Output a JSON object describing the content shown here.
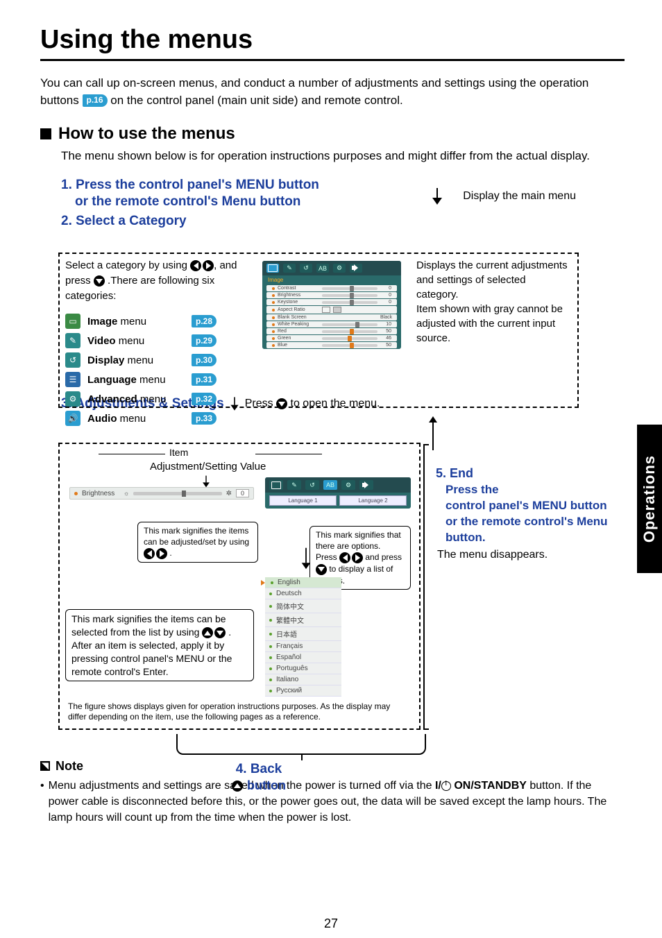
{
  "page_number": "27",
  "sidetab": "Operations",
  "title": "Using the menus",
  "intro_a": "You can call up on-screen menus, and conduct a number of adjustments and settings using the operation buttons ",
  "intro_pref": "p.16",
  "intro_b": " on the control panel (main unit side) and remote control.",
  "howto_heading": "How to use the menus",
  "howto_sub": "The menu shown below is for operation instructions purposes and might differ from the actual display.",
  "step1_a": "1. Press the control panel's MENU button",
  "step1_b": "or the remote control's Menu button",
  "display_main": "Display the main menu",
  "step2": "2. Select a Category",
  "select_cat_a": "Select a category by using ",
  "select_cat_b": ", and press ",
  "select_cat_c": " .There are following six categories:",
  "menus": [
    {
      "name": "Image",
      "suffix": " menu",
      "page": "p.28"
    },
    {
      "name": "Video",
      "suffix": " menu",
      "page": "p.29"
    },
    {
      "name": "Display",
      "suffix": " menu",
      "page": "p.30"
    },
    {
      "name": "Language",
      "suffix": " menu",
      "page": "p.31"
    },
    {
      "name": "Advanced",
      "suffix": " menu",
      "page": "p.32"
    },
    {
      "name": "Audio",
      "suffix": " menu",
      "page": "p.33"
    }
  ],
  "osd": {
    "title": "Image",
    "rows": [
      {
        "label": "Contrast",
        "val": "0",
        "thumb": 50
      },
      {
        "label": "Brightness",
        "val": "0",
        "thumb": 50
      },
      {
        "label": "Keystone",
        "val": "0",
        "thumb": 50
      },
      {
        "label": "Aspect Ratio",
        "val": "",
        "thumb": null,
        "icon": true
      },
      {
        "label": "Blank Screen",
        "val": "Black",
        "thumb": null
      },
      {
        "label": "White Peaking",
        "val": "10",
        "thumb": 60
      },
      {
        "label": "Red",
        "val": "50",
        "thumb": 50,
        "color": true
      },
      {
        "label": "Green",
        "val": "46",
        "thumb": 46,
        "color": true
      },
      {
        "label": "Blue",
        "val": "50",
        "thumb": 50,
        "color": true
      }
    ]
  },
  "cat_right": "Displays the current adjustments and settings of selected category.\nItem shown with gray cannot be adjusted with the current input source.",
  "step3": "3. Adjustments & Settings",
  "step3_suffix_a": "Press ",
  "step3_suffix_b": " to open the menu.",
  "item_label": "Item",
  "adj_label": "Adjustment/Setting Value",
  "single_row": {
    "label": "Brightness",
    "val": "0"
  },
  "box1_a": "This mark signifies the items can be adjusted/set by using ",
  "box1_b": ".",
  "box2_a": "This mark signifies that there are options.",
  "box2_b": "Press ",
  "box2_c": " and press ",
  "box2_d": " to display a list of options.",
  "box3_a": "This mark signifies the items can be selected from the list by using ",
  "box3_b": ".",
  "box3_c": "After an item is selected, apply it by pressing control panel's MENU or the remote control's Enter.",
  "lang_cols": {
    "a": "Language  1",
    "b": "Language  2"
  },
  "languages": [
    "English",
    "Deutsch",
    "简体中文",
    "繁體中文",
    "日本語",
    "Français",
    "Español",
    "Português",
    "Italiano",
    "Русский"
  ],
  "fig_note": "The figure shows displays given for operation instructions purposes.  As the display may differ depending on the item, use the following pages as a reference.",
  "step4": "4. Back",
  "step4_btn": " button",
  "step5_head": "5. End",
  "step5_body": "Press the\ncontrol panel's MENU button or the remote control's Menu  button.",
  "step5_desc": "The menu disappears.",
  "note_heading": "Note",
  "note_a": "Menu adjustments and settings are saved when the power is turned off via the ",
  "note_btn": "ON/STANDBY",
  "note_prefix": "I/",
  "note_b": " button. If the power cable is disconnected before this, or the power goes out, the data will be saved except the lamp hours. The lamp hours will count up from the time when the power is lost."
}
